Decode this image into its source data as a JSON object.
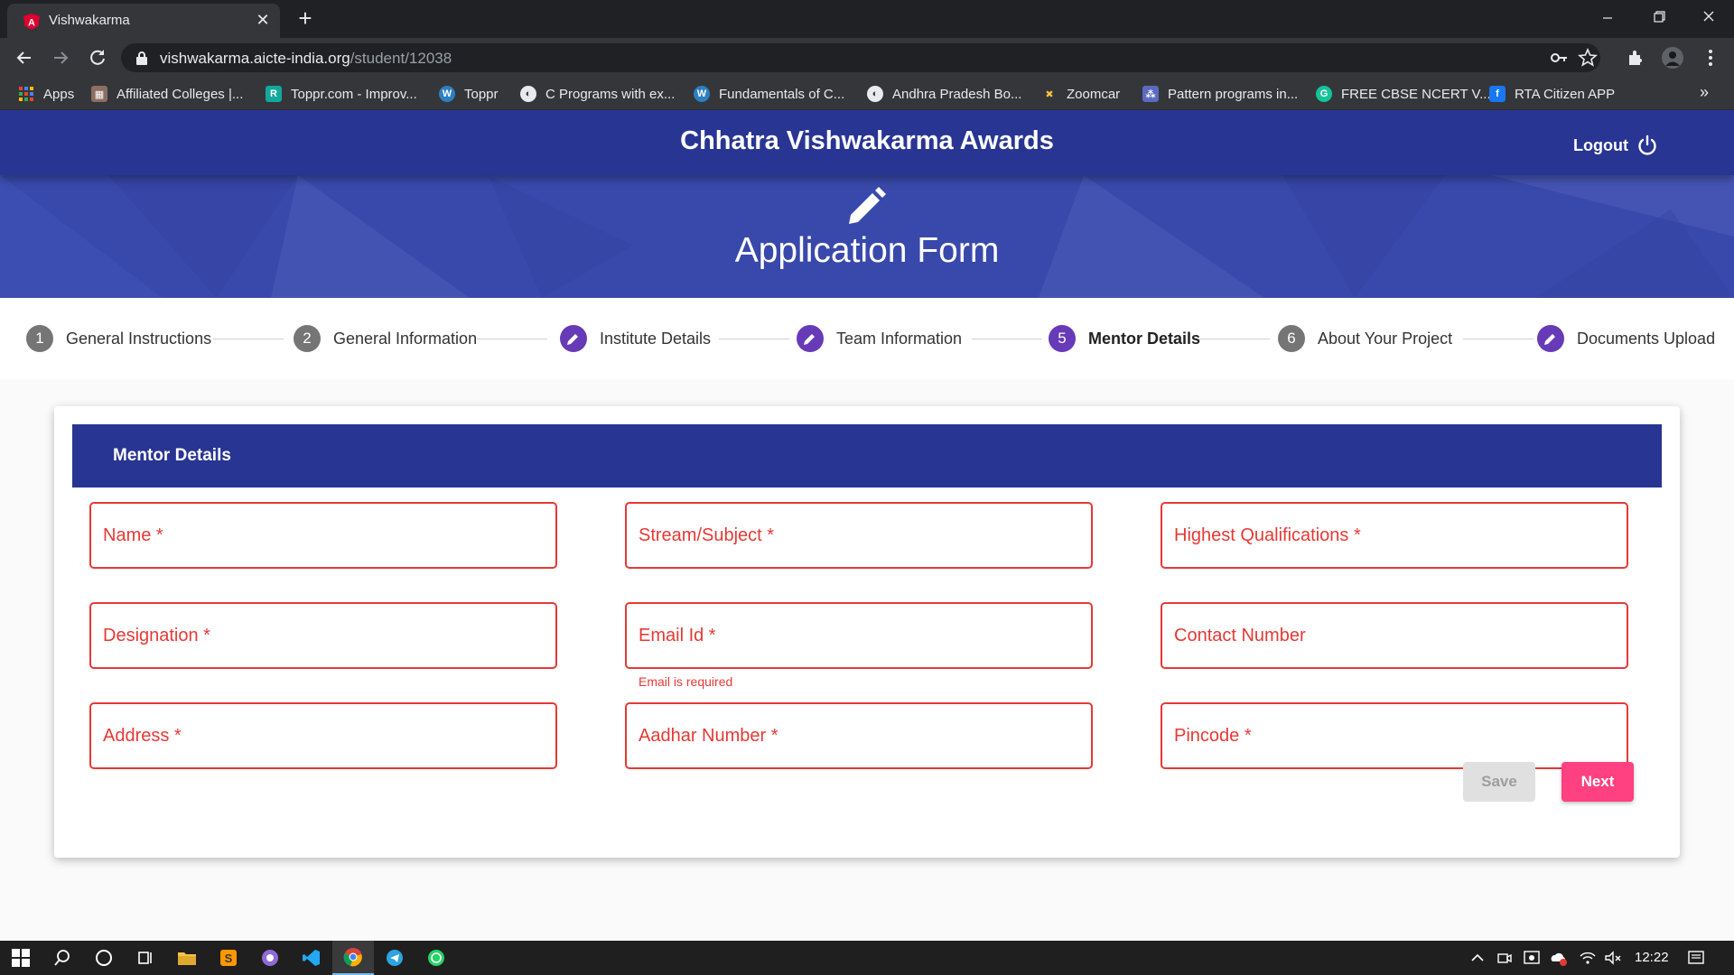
{
  "browser": {
    "tab_title": "Vishwakarma",
    "url_host": "vishwakarma.aicte-india.org",
    "url_path": "/student/12038",
    "bookmarks": [
      {
        "label": "Apps",
        "icon": "apps-grid-icon"
      },
      {
        "label": "Affiliated Colleges |...",
        "icon": "college-icon"
      },
      {
        "label": "Toppr.com - Improv...",
        "icon": "toppr-icon"
      },
      {
        "label": "Toppr",
        "icon": "wordpress-icon"
      },
      {
        "label": "C Programs with ex...",
        "icon": "globe-icon"
      },
      {
        "label": "Fundamentals of C...",
        "icon": "wordpress-icon"
      },
      {
        "label": "Andhra Pradesh Bo...",
        "icon": "globe-icon"
      },
      {
        "label": "Zoomcar",
        "icon": "zoomcar-icon"
      },
      {
        "label": "Pattern programs in...",
        "icon": "pattern-icon"
      },
      {
        "label": "FREE CBSE NCERT V...",
        "icon": "grammarly-icon"
      },
      {
        "label": "RTA Citizen APP",
        "icon": "facebook-icon"
      }
    ]
  },
  "header": {
    "app_title": "Chhatra Vishwakarma Awards",
    "logout_label": "Logout",
    "form_heading": "Application Form"
  },
  "stepper": {
    "steps": [
      {
        "marker": "1",
        "label": "General Instructions",
        "state": "number"
      },
      {
        "marker": "2",
        "label": "General Information",
        "state": "number"
      },
      {
        "marker": "",
        "label": "Institute Details",
        "state": "edit"
      },
      {
        "marker": "",
        "label": "Team Information",
        "state": "edit"
      },
      {
        "marker": "5",
        "label": "Mentor Details",
        "state": "active"
      },
      {
        "marker": "6",
        "label": "About Your Project",
        "state": "number"
      },
      {
        "marker": "",
        "label": "Documents Upload",
        "state": "edit"
      }
    ]
  },
  "form": {
    "section_title": "Mentor Details",
    "fields": {
      "name": "Name *",
      "stream": "Stream/Subject *",
      "qualification": "Highest Qualifications *",
      "designation": "Designation *",
      "email": "Email Id *",
      "contact": "Contact Number",
      "address": "Address *",
      "aadhar": "Aadhar Number *",
      "pincode": "Pincode *"
    },
    "email_error": "Email is required",
    "save_label": "Save",
    "next_label": "Next"
  },
  "taskbar": {
    "time": "12:22"
  },
  "colors": {
    "primary": "#283593",
    "hero": "#3949ab",
    "accent": "#ff4081",
    "error": "#e53935",
    "step_done": "#673ab7"
  }
}
